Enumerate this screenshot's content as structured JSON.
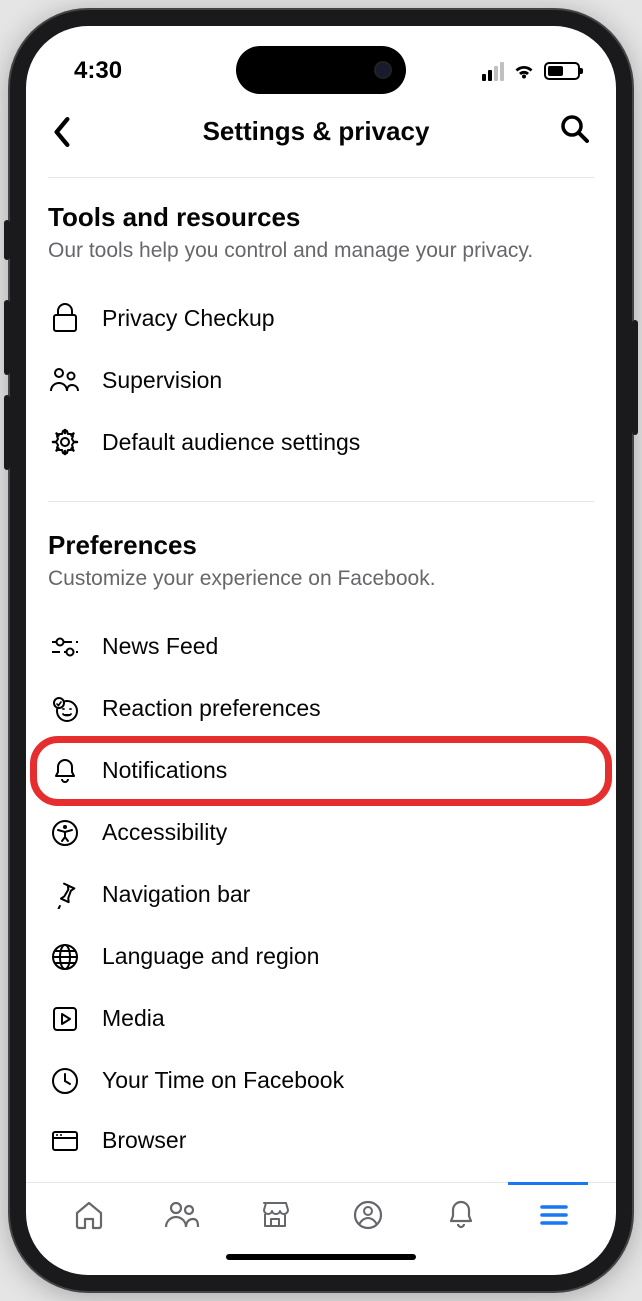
{
  "statusBar": {
    "time": "4:30"
  },
  "header": {
    "title": "Settings & privacy"
  },
  "sections": [
    {
      "title": "Tools and resources",
      "desc": "Our tools help you control and manage your privacy.",
      "items": [
        {
          "label": "Privacy Checkup",
          "icon": "lock-icon"
        },
        {
          "label": "Supervision",
          "icon": "people-icon"
        },
        {
          "label": "Default audience settings",
          "icon": "gear-icon"
        }
      ]
    },
    {
      "title": "Preferences",
      "desc": "Customize your experience on Facebook.",
      "items": [
        {
          "label": "News Feed",
          "icon": "feed-sliders-icon"
        },
        {
          "label": "Reaction preferences",
          "icon": "reaction-icon"
        },
        {
          "label": "Notifications",
          "icon": "bell-icon",
          "highlighted": true
        },
        {
          "label": "Accessibility",
          "icon": "accessibility-icon"
        },
        {
          "label": "Navigation bar",
          "icon": "pin-icon"
        },
        {
          "label": "Language and region",
          "icon": "globe-icon"
        },
        {
          "label": "Media",
          "icon": "play-box-icon"
        },
        {
          "label": "Your Time on Facebook",
          "icon": "clock-icon"
        },
        {
          "label": "Browser",
          "icon": "browser-icon"
        }
      ]
    }
  ],
  "bottomNav": {
    "items": [
      {
        "name": "home-icon"
      },
      {
        "name": "friends-icon"
      },
      {
        "name": "marketplace-icon"
      },
      {
        "name": "profile-icon"
      },
      {
        "name": "notifications-icon"
      },
      {
        "name": "menu-icon",
        "active": true
      }
    ]
  }
}
